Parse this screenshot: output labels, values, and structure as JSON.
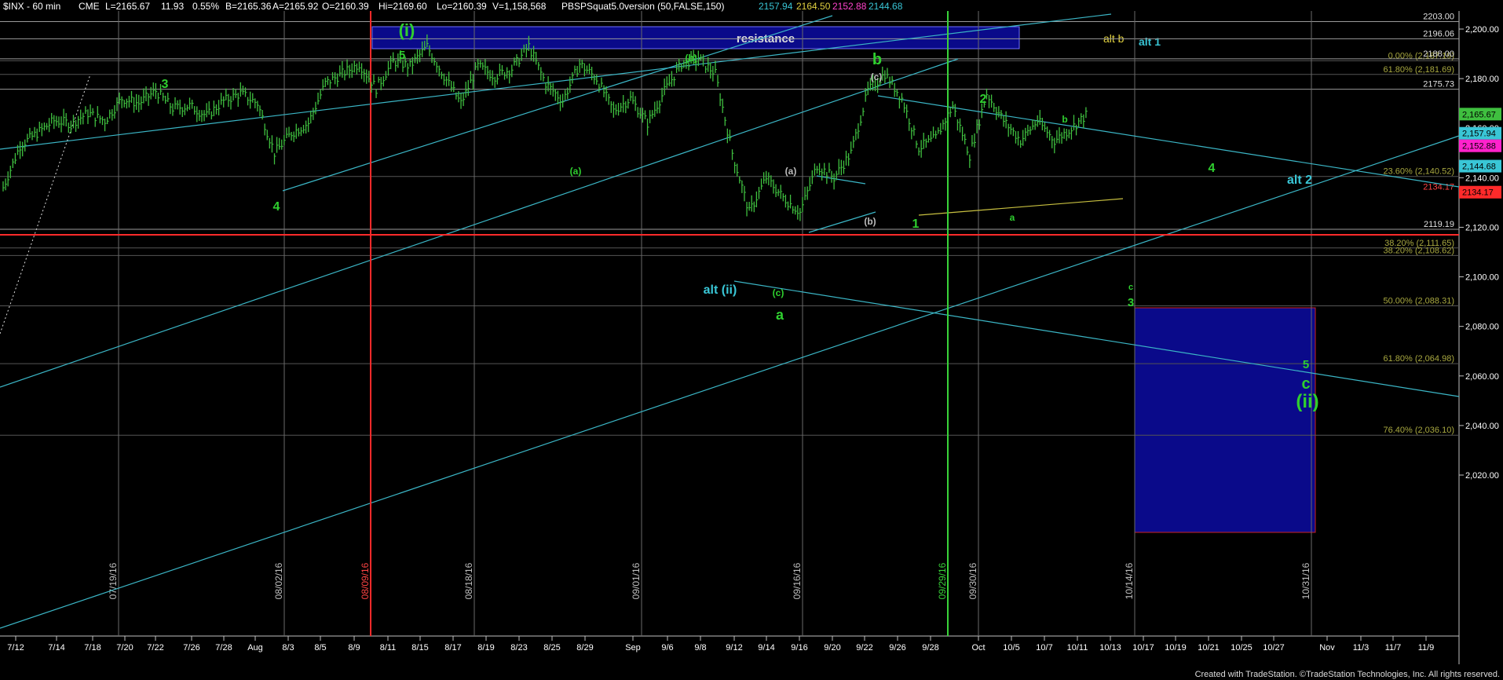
{
  "header": {
    "symbol": "$INX - 60 min",
    "exchange": "CME",
    "last": "L=2165.67",
    "change": "11.93",
    "change_pct": "0.55%",
    "bid": "B=2165.36",
    "ask": "A=2165.92",
    "open": "O=2160.39",
    "high": "Hi=2169.60",
    "low": "Lo=2160.39",
    "volume": "V=1,158,568",
    "indicator": "PBSPSquat5.0version (50,FALSE,150)",
    "ind_values": [
      "2157.94",
      "2164.50",
      "2152.88",
      "2144.68"
    ]
  },
  "colors": {
    "background": "#000000",
    "price_bars": "#3fbf3f",
    "channel": "#3bb6c6",
    "red_line": "#ff2a2a",
    "green_line": "#39d339",
    "blue_box": "#0a0a8a",
    "fib_text": "#9a9a44",
    "label_green": "#2fcf2f",
    "label_cyan": "#39c6d6"
  },
  "footer": "Created with TradeStation. ©TradeStation Technologies, Inc. All rights reserved.",
  "chart_data": {
    "type": "line",
    "title": "$INX - 60 min",
    "xlabel": "",
    "ylabel": "",
    "ylim": [
      2000,
      2206
    ],
    "grid": false,
    "x_ticks": [
      "7/12",
      "7/14",
      "7/18",
      "7/20",
      "7/22",
      "7/26",
      "7/28",
      "Aug",
      "8/3",
      "8/5",
      "8/9",
      "8/11",
      "8/15",
      "8/17",
      "8/19",
      "8/23",
      "8/25",
      "8/29",
      "Sep",
      "9/6",
      "9/8",
      "9/12",
      "9/14",
      "9/16",
      "9/20",
      "9/22",
      "9/26",
      "9/28",
      "Oct",
      "10/5",
      "10/7",
      "10/11",
      "10/13",
      "10/17",
      "10/19",
      "10/21",
      "10/25",
      "10/27",
      "Nov",
      "11/3",
      "11/7",
      "11/9"
    ],
    "y_ticks": [
      "2,200.00",
      "2,180.00",
      "2,160.00",
      "2,140.00",
      "2,120.00",
      "2,100.00",
      "2,080.00",
      "2,060.00",
      "2,040.00",
      "2,020.00"
    ],
    "vertical_dates": [
      "07/19/16",
      "08/02/16",
      "08/09/16",
      "08/18/16",
      "09/01/16",
      "09/16/16",
      "09/29/16",
      "09/30/16",
      "10/14/16",
      "10/31/16"
    ],
    "price_path": [
      [
        "7/11",
        2136
      ],
      [
        "7/12",
        2153
      ],
      [
        "7/13",
        2158
      ],
      [
        "7/14",
        2163
      ],
      [
        "7/15",
        2162
      ],
      [
        "7/18",
        2166
      ],
      [
        "7/19",
        2163
      ],
      [
        "7/20",
        2172
      ],
      [
        "7/21",
        2170
      ],
      [
        "7/22",
        2175
      ],
      [
        "7/25",
        2168
      ],
      [
        "7/26",
        2169
      ],
      [
        "7/27",
        2165
      ],
      [
        "7/28",
        2171
      ],
      [
        "7/29",
        2174
      ],
      [
        "8/1",
        2170
      ],
      [
        "8/2",
        2150
      ],
      [
        "8/3",
        2158
      ],
      [
        "8/4",
        2162
      ],
      [
        "8/5",
        2178
      ],
      [
        "8/8",
        2182
      ],
      [
        "8/9",
        2186
      ],
      [
        "8/10",
        2176
      ],
      [
        "8/11",
        2187
      ],
      [
        "8/12",
        2185
      ],
      [
        "8/15",
        2193
      ],
      [
        "8/16",
        2181
      ],
      [
        "8/17",
        2170
      ],
      [
        "8/18",
        2185
      ],
      [
        "8/19",
        2181
      ],
      [
        "8/22",
        2184
      ],
      [
        "8/23",
        2193
      ],
      [
        "8/24",
        2178
      ],
      [
        "8/25",
        2171
      ],
      [
        "8/26",
        2186
      ],
      [
        "8/29",
        2180
      ],
      [
        "8/30",
        2167
      ],
      [
        "8/31",
        2172
      ],
      [
        "9/1",
        2162
      ],
      [
        "9/2",
        2175
      ],
      [
        "9/6",
        2186
      ],
      [
        "9/7",
        2188
      ],
      [
        "9/8",
        2182
      ],
      [
        "9/9",
        2150
      ],
      [
        "9/12",
        2126
      ],
      [
        "9/13",
        2140
      ],
      [
        "9/14",
        2132
      ],
      [
        "9/15",
        2126
      ],
      [
        "9/16",
        2145
      ],
      [
        "9/19",
        2140
      ],
      [
        "9/20",
        2150
      ],
      [
        "9/21",
        2175
      ],
      [
        "9/22",
        2182
      ],
      [
        "9/23",
        2172
      ],
      [
        "9/26",
        2152
      ],
      [
        "9/27",
        2156
      ],
      [
        "9/28",
        2169
      ],
      [
        "9/29",
        2149
      ],
      [
        "9/30",
        2174
      ],
      [
        "10/3",
        2163
      ],
      [
        "10/4",
        2155
      ],
      [
        "10/5",
        2163
      ],
      [
        "10/6",
        2155
      ],
      [
        "10/7",
        2160
      ],
      [
        "10/10",
        2166
      ]
    ],
    "horizontal_levels": [
      {
        "label": "2203.00",
        "value": 2203.0
      },
      {
        "label": "2196.06",
        "value": 2196.06
      },
      {
        "label": "0.00% (2,187.19)",
        "value": 2187.19
      },
      {
        "label": "2188.00",
        "value": 2188.0
      },
      {
        "label": "61.80% (2,181.69)",
        "value": 2181.69
      },
      {
        "label": "2175.73",
        "value": 2175.73
      },
      {
        "label": "23.60% (2,140.52)",
        "value": 2140.52
      },
      {
        "label": "2134.17",
        "value": 2134.17
      },
      {
        "label": "2119.19",
        "value": 2119.19
      },
      {
        "label": "38.20% (2,111.65)",
        "value": 2111.65
      },
      {
        "label": "38.20% (2,108.62)",
        "value": 2108.62
      },
      {
        "label": "50.00% (2,088.31)",
        "value": 2088.31
      },
      {
        "label": "61.80% (2,064.98)",
        "value": 2064.98
      },
      {
        "label": "76.40% (2,036.10)",
        "value": 2036.1
      }
    ],
    "price_tags": [
      {
        "value": "2,165.67",
        "price": 2165.67,
        "bg": "#3fbf3f",
        "fg": "#000"
      },
      {
        "value": "2,157.94",
        "price": 2157.94,
        "bg": "#39c6d6",
        "fg": "#000"
      },
      {
        "value": "2,152.88",
        "price": 2152.88,
        "bg": "#ff22cc",
        "fg": "#000"
      },
      {
        "value": "2,144.68",
        "price": 2144.68,
        "bg": "#39c6d6",
        "fg": "#000"
      },
      {
        "value": "2134.17",
        "price": 2134.17,
        "bg": "#ff2a2a",
        "fg": "#000"
      }
    ],
    "annotations": [
      {
        "text": "resistance",
        "color": "#dddddd"
      },
      {
        "text": "alt b",
        "color": "#e0d040"
      },
      {
        "text": "alt 1",
        "color": "#39c6d6"
      },
      {
        "text": "(i)",
        "color": "#2fcf2f"
      },
      {
        "text": "(ii)",
        "color": "#2fcf2f"
      },
      {
        "text": "alt (ii)",
        "color": "#39c6d6"
      },
      {
        "text": "alt 2",
        "color": "#39c6d6"
      },
      {
        "text": "resistance box",
        "color": "#0a0a8a"
      }
    ],
    "wave_labels": [
      "3",
      "4",
      "5",
      "(b)",
      "(a)",
      "(a)",
      "(b)",
      "(c)",
      "(c)",
      "b",
      "a",
      "1",
      "2",
      "b",
      "a",
      "4",
      "c",
      "3",
      "5",
      "c"
    ]
  }
}
